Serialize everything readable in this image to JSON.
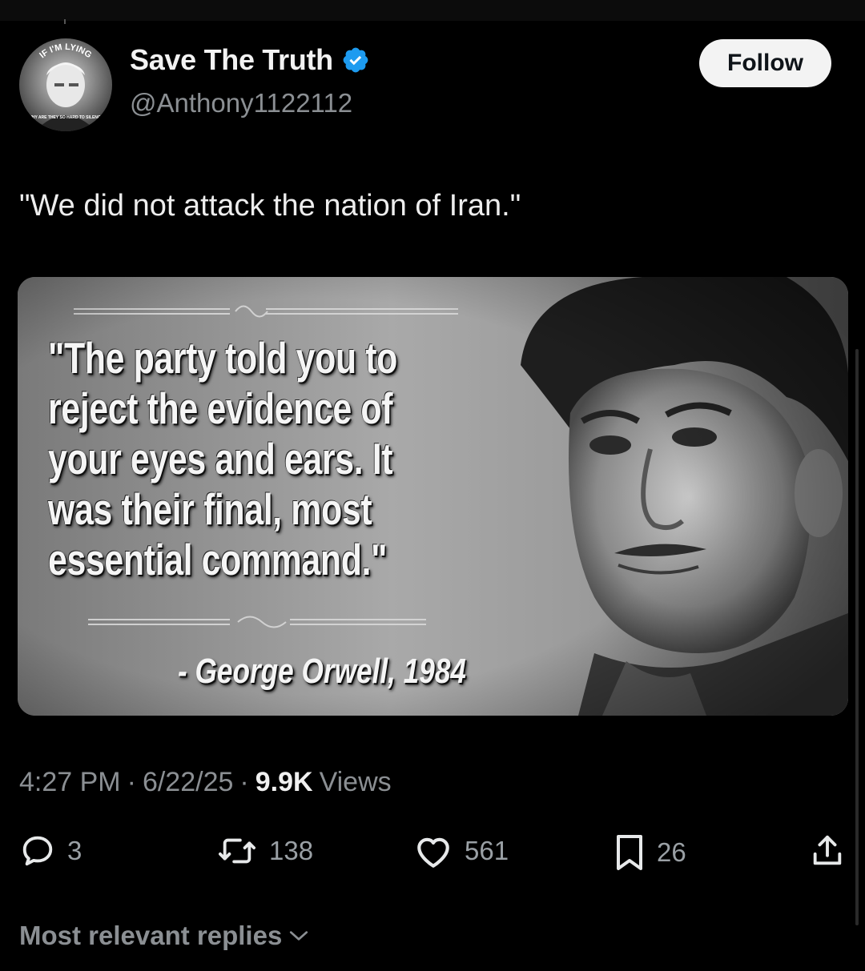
{
  "author": {
    "display_name": "Save The Truth",
    "handle": "@Anthony1122112",
    "verified": true,
    "avatar_text_top": "IF I'M LYING",
    "avatar_text_bottom": "WHY ARE THEY SO HARD TO SILENCE"
  },
  "follow_button": {
    "label": "Follow"
  },
  "tweet": {
    "text": "\"We did not attack the nation of Iran.\""
  },
  "media": {
    "quote_lines": [
      "\"The party told you to",
      "reject the evidence of",
      "your eyes and ears. It",
      "was their final, most",
      "essential command.\""
    ],
    "attribution": "- George Orwell, 1984"
  },
  "meta": {
    "time": "4:27 PM",
    "date": "6/22/25",
    "separator": "·",
    "views_count": "9.9K",
    "views_label": "Views"
  },
  "actions": {
    "replies": "3",
    "reposts": "138",
    "likes": "561",
    "bookmarks": "26"
  },
  "replies_sort": {
    "label": "Most relevant replies"
  },
  "colors": {
    "background": "#000000",
    "verified_blue": "#1d9bf0",
    "muted_text": "#8b8f93"
  }
}
